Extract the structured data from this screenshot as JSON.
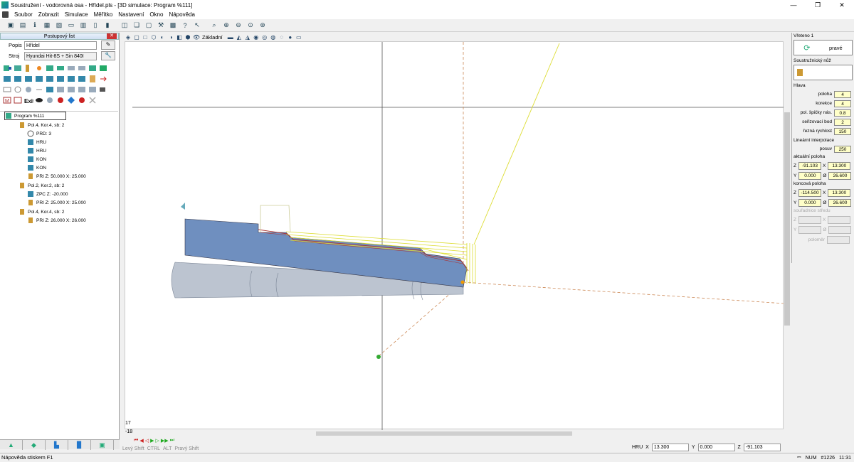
{
  "window": {
    "title": "Soustružení - vodorovná osa - Hřídel.pls - [3D simulace: Program %111]"
  },
  "menu": [
    "Soubor",
    "Zobrazit",
    "Simulace",
    "Měřítko",
    "Nastavení",
    "Okno",
    "Nápověda"
  ],
  "left_panel": {
    "title": "Postupový list",
    "popis_label": "Popis",
    "popis_value": "Hřídel",
    "stroj_label": "Stroj",
    "stroj_value": "Hyundai Hit-8S + Sin 840I",
    "tree": [
      "Program %111",
      "Pol.4, Kor.4, sb: 2",
      "PRD: 3",
      "HRU",
      "HRU",
      "KON",
      "KON",
      "PRI  Z:  50.000  X:  25.000",
      "Pol.2, Kor.2, sb: 2",
      "ZPC  Z:  -20.000",
      "PRI  Z:  25.000  X:  25.000",
      "Pol.4, Kor.4, sb: 2",
      "PRI  Z:  26.000  X:  26.000"
    ]
  },
  "viewer": {
    "view_label": "Základní",
    "ruler_top": "17",
    "ruler_bottom": "-18",
    "modifiers": [
      "Levý Shift",
      "CTRL",
      "ALT",
      "Pravý Shift"
    ]
  },
  "right_panel": {
    "spindle_title": "Vřeteno 1",
    "spindle_dir": "pravé",
    "tool_title": "Soustružnický nůž",
    "head_title": "Hlava",
    "head_rows": [
      {
        "label": "poloha",
        "value": "4"
      },
      {
        "label": "korekce",
        "value": "4"
      },
      {
        "label": "pol. špičky nás.",
        "value": "0.8"
      },
      {
        "label": "seřizovací bod",
        "value": "2"
      },
      {
        "label": "řezná rychlost",
        "value": "150"
      }
    ],
    "interp_title": "Lineární interpolace",
    "posuv_label": "posuv",
    "posuv_value": "250",
    "actual_title": "aktuální poloha",
    "actual": {
      "Z": "-91.103",
      "X": "13.300",
      "Y": "0.000",
      "D": "26.600"
    },
    "end_title": "koncová poloha",
    "end": {
      "Z": "-114.500",
      "X": "13.300",
      "Y": "0.000",
      "D": "26.600"
    },
    "center_title": "souřadnice středu",
    "radius_label": "poloměr"
  },
  "coordbar": {
    "mode": "HRU",
    "x_label": "X",
    "x_value": "13.300",
    "y_label": "Y",
    "y_value": "0.000",
    "z_label": "Z",
    "z_value": "-91.103"
  },
  "status": {
    "help": "Nápověda stiskem F1",
    "num": "NUM",
    "line": "#1226",
    "time": "11:31"
  }
}
